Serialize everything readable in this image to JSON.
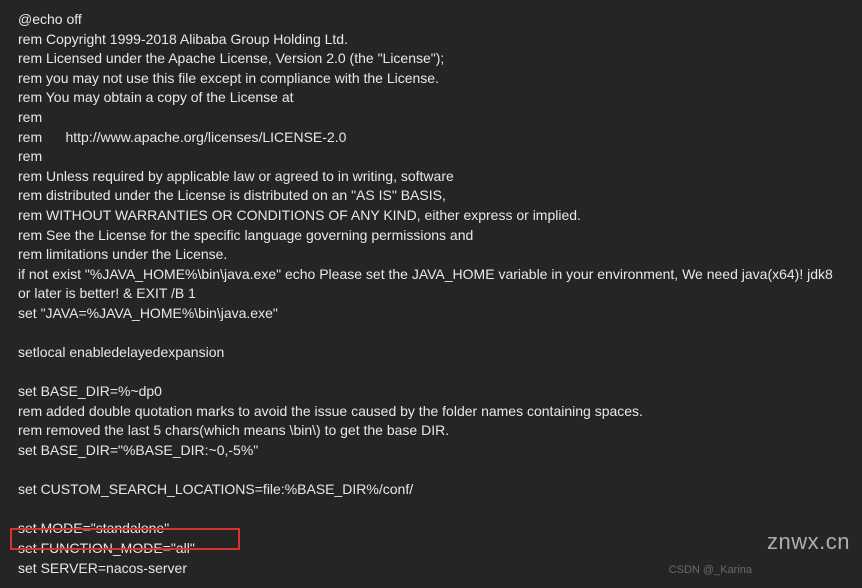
{
  "code": {
    "lines": [
      "@echo off",
      "rem Copyright 1999-2018 Alibaba Group Holding Ltd.",
      "rem Licensed under the Apache License, Version 2.0 (the \"License\");",
      "rem you may not use this file except in compliance with the License.",
      "rem You may obtain a copy of the License at",
      "rem",
      "rem      http://www.apache.org/licenses/LICENSE-2.0",
      "rem",
      "rem Unless required by applicable law or agreed to in writing, software",
      "rem distributed under the License is distributed on an \"AS IS\" BASIS,",
      "rem WITHOUT WARRANTIES OR CONDITIONS OF ANY KIND, either express or implied.",
      "rem See the License for the specific language governing permissions and",
      "rem limitations under the License.",
      "if not exist \"%JAVA_HOME%\\bin\\java.exe\" echo Please set the JAVA_HOME variable in your environment, We need java(x64)! jdk8 or later is better! & EXIT /B 1",
      "set \"JAVA=%JAVA_HOME%\\bin\\java.exe\"",
      "",
      "setlocal enabledelayedexpansion",
      "",
      "set BASE_DIR=%~dp0",
      "rem added double quotation marks to avoid the issue caused by the folder names containing spaces.",
      "rem removed the last 5 chars(which means \\bin\\) to get the base DIR.",
      "set BASE_DIR=\"%BASE_DIR:~0,-5%\"",
      "",
      "set CUSTOM_SEARCH_LOCATIONS=file:%BASE_DIR%/conf/",
      "",
      "set MODE=\"standalone\"",
      "set FUNCTION_MODE=\"all\"",
      "set SERVER=nacos-server"
    ]
  },
  "highlight": {
    "top": "528",
    "left": "10",
    "width": "230",
    "height": "22"
  },
  "watermarks": {
    "right": "znwx.cn",
    "bottom": "CSDN @_Karina"
  }
}
